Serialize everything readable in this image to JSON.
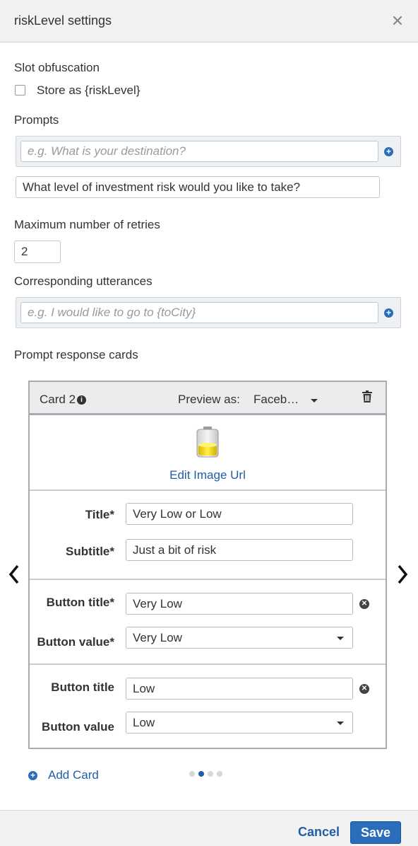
{
  "dialog": {
    "title": "riskLevel settings"
  },
  "slot_obfuscation": {
    "label": "Slot obfuscation",
    "checkbox_label": "Store as {riskLevel}",
    "checked": false
  },
  "prompts": {
    "label": "Prompts",
    "new_placeholder": "e.g. What is your destination?",
    "items": [
      "What level of investment risk would you like to take?"
    ]
  },
  "retries": {
    "label": "Maximum number of retries",
    "value": "2"
  },
  "utterances": {
    "label": "Corresponding utterances",
    "placeholder": "e.g. I would like to go to {toCity}"
  },
  "response_cards": {
    "label": "Prompt response cards",
    "card": {
      "name": "Card 2",
      "preview_label": "Preview as:",
      "preview_value": "Faceb…",
      "edit_image_label": "Edit Image Url",
      "title_label": "Title*",
      "title_value": "Very Low or Low",
      "subtitle_label": "Subtitle*",
      "subtitle_value": "Just a bit of risk",
      "buttons": [
        {
          "title_label": "Button title*",
          "title_value": "Very Low",
          "value_label": "Button value*",
          "value": "Very Low"
        },
        {
          "title_label": "Button title",
          "title_value": "Low",
          "value_label": "Button value",
          "value": "Low"
        }
      ]
    },
    "add_card_label": "Add Card",
    "pagination": {
      "total": 4,
      "current": 2
    }
  },
  "footer": {
    "cancel_label": "Cancel",
    "save_label": "Save"
  },
  "colors": {
    "accent": "#2a6ebb",
    "link": "#1f5fa5",
    "header_bg": "#f2f2f2"
  }
}
